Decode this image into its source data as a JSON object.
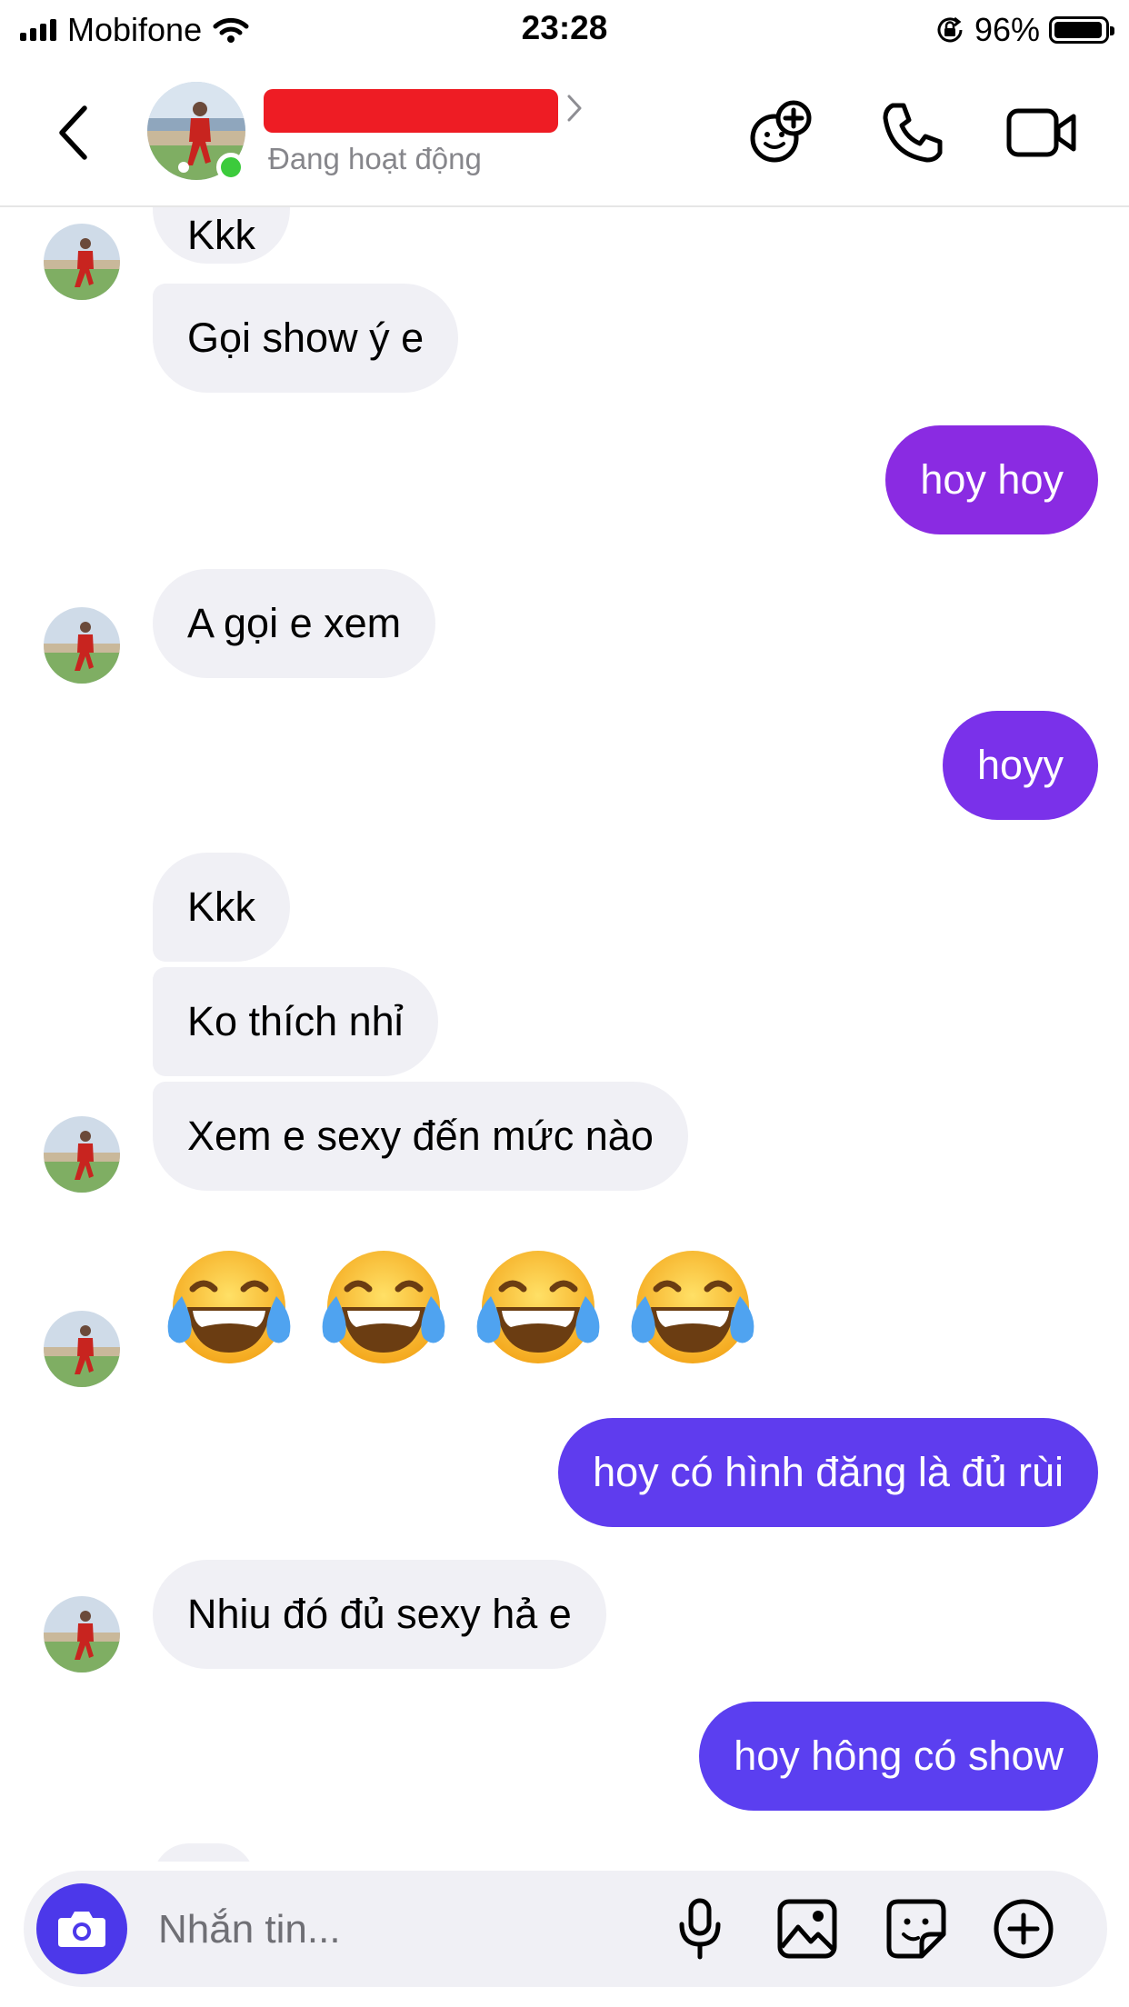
{
  "status_bar": {
    "carrier": "Mobifone",
    "time": "23:28",
    "battery_percent": "96%",
    "battery_level": 0.96,
    "icons": [
      "signal-icon",
      "wifi-icon",
      "orientation-lock-icon",
      "battery-icon"
    ]
  },
  "header": {
    "contact_name": "",
    "active_status": "Đang hoạt động",
    "online": true,
    "icons": [
      "back-icon",
      "chevron-right-icon",
      "effects-icon",
      "phone-icon",
      "video-call-icon"
    ]
  },
  "colors": {
    "accent": "#4c38ea",
    "outgoing_gradient": [
      "#8a2be2",
      "#5b3ff0"
    ],
    "incoming_bubble": "#f0f0f5",
    "online": "#3ccb3c",
    "redaction": "#ee1c24"
  },
  "messages": [
    {
      "from": "them",
      "text": "Kkk"
    },
    {
      "from": "them",
      "text": "Gọi show ý e"
    },
    {
      "from": "me",
      "text": "hoy hoy"
    },
    {
      "from": "them",
      "text": "A gọi e xem"
    },
    {
      "from": "me",
      "text": "hoyy"
    },
    {
      "from": "them",
      "text": "Kkk"
    },
    {
      "from": "them",
      "text": "Ko thích nhỉ"
    },
    {
      "from": "them",
      "text": "Xem e sexy đến mức nào"
    },
    {
      "from": "them",
      "text": "😂😂😂😂",
      "emoji_count": 4,
      "emoji_name": "face-with-tears-of-joy"
    },
    {
      "from": "me",
      "text": "hoy có hình đăng là đủ rùi"
    },
    {
      "from": "them",
      "text": "Nhiu đó đủ sexy hả e"
    },
    {
      "from": "me",
      "text": "hoy hông có show"
    }
  ],
  "composer": {
    "placeholder": "Nhắn tin...",
    "icons": [
      "camera-icon",
      "microphone-icon",
      "gallery-icon",
      "sticker-icon",
      "plus-icon"
    ]
  }
}
